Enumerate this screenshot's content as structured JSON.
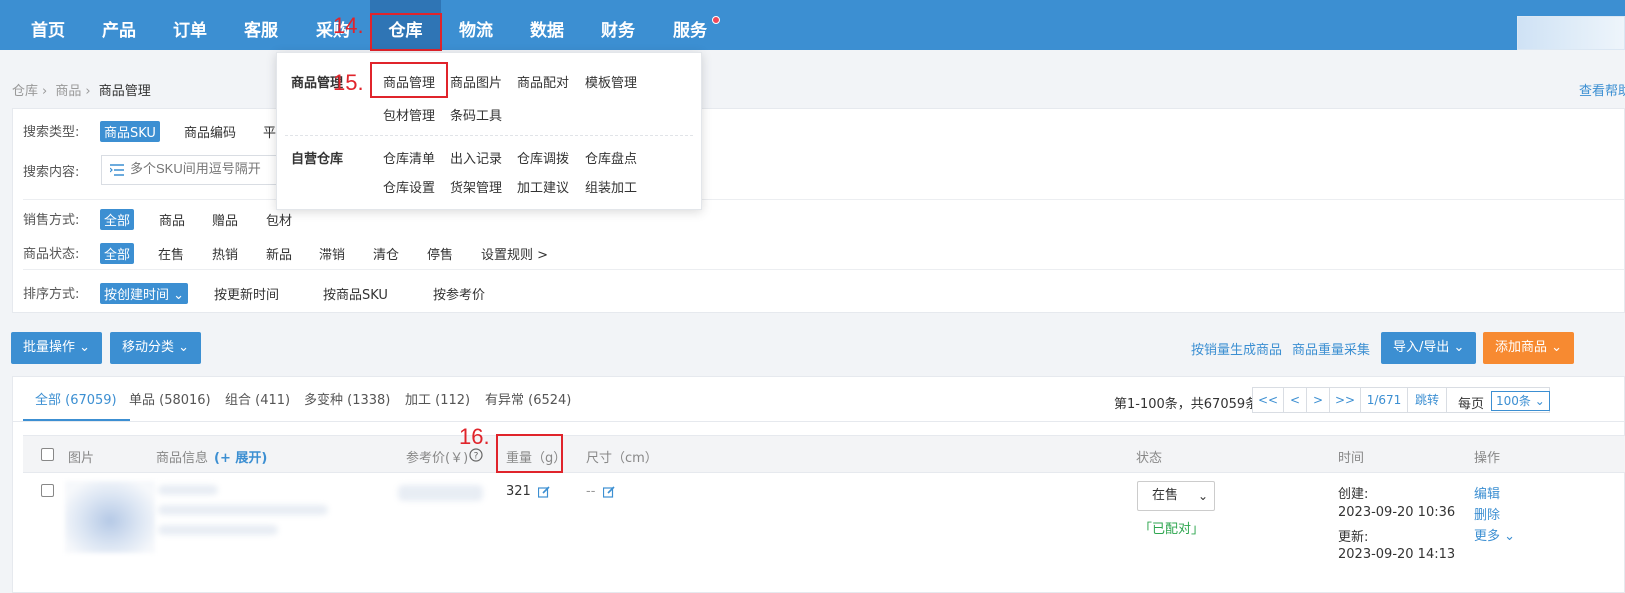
{
  "nav": {
    "items": [
      "首页",
      "产品",
      "订单",
      "客服",
      "采购",
      "仓库",
      "物流",
      "数据",
      "财务",
      "服务"
    ],
    "active": "仓库"
  },
  "annotations": {
    "a14": "14.",
    "a15": "15.",
    "a16": "16."
  },
  "breadcrumb": [
    "仓库",
    "商品",
    "商品管理"
  ],
  "help_link": "查看帮助",
  "dropdown": {
    "group1": "商品管理",
    "group1_items_row1": [
      "商品管理",
      "商品图片",
      "商品配对",
      "模板管理"
    ],
    "group1_items_row2": [
      "包材管理",
      "条码工具"
    ],
    "group2": "自营仓库",
    "group2_items_row1": [
      "仓库清单",
      "出入记录",
      "仓库调拨",
      "仓库盘点"
    ],
    "group2_items_row2": [
      "仓库设置",
      "货架管理",
      "加工建议",
      "组装加工"
    ]
  },
  "filters": {
    "search_type_label": "搜索类型:",
    "search_type_options": [
      "商品SKU",
      "商品编码",
      "平"
    ],
    "search_content_label": "搜索内容:",
    "search_placeholder": "多个SKU间用逗号隔开",
    "sale_mode_label": "销售方式:",
    "sale_mode_options": [
      "全部",
      "商品",
      "赠品",
      "包材"
    ],
    "status_label": "商品状态:",
    "status_options": [
      "全部",
      "在售",
      "热销",
      "新品",
      "滞销",
      "清仓",
      "停售",
      "设置规则 >"
    ],
    "sort_label": "排序方式:",
    "sort_options": [
      "按创建时间",
      "按更新时间",
      "按商品SKU",
      "按参考价"
    ]
  },
  "actions": {
    "batch": "批量操作",
    "move": "移动分类",
    "gen_by_sales": "按销量生成商品",
    "weight_collect": "商品重量采集",
    "import_export": "导入/导出",
    "add": "添加商品"
  },
  "tabs": [
    "全部 (67059)",
    "单品 (58016)",
    "组合 (411)",
    "多变种 (1338)",
    "加工 (112)",
    "有异常 (6524)"
  ],
  "pager": {
    "summary": "第1-100条，共67059条",
    "first": "<<",
    "prev": "<",
    "next": ">",
    "last": ">>",
    "page": "1/671",
    "jump": "跳转",
    "per_page_label": "每页",
    "per_page_value": "100条"
  },
  "table": {
    "headers": {
      "image": "图片",
      "info": "商品信息",
      "expand": "(+ 展开)",
      "price": "参考价(￥)",
      "weight": "重量（g）",
      "size": "尺寸（cm）",
      "status": "状态",
      "time": "时间",
      "ops": "操作"
    },
    "row": {
      "weight": "321",
      "size": "--",
      "status": "在售",
      "matched": "「已配对」",
      "created_label": "创建:",
      "created": "2023-09-20 10:36",
      "updated_label": "更新:",
      "updated": "2023-09-20 14:13",
      "ops": [
        "编辑",
        "删除",
        "更多"
      ]
    }
  },
  "colors": {
    "nav_bg": "#3c8fd2",
    "accent": "#3c8fd2",
    "orange": "#f78a31",
    "annotation": "#e0242b",
    "success": "#2ea64f"
  }
}
